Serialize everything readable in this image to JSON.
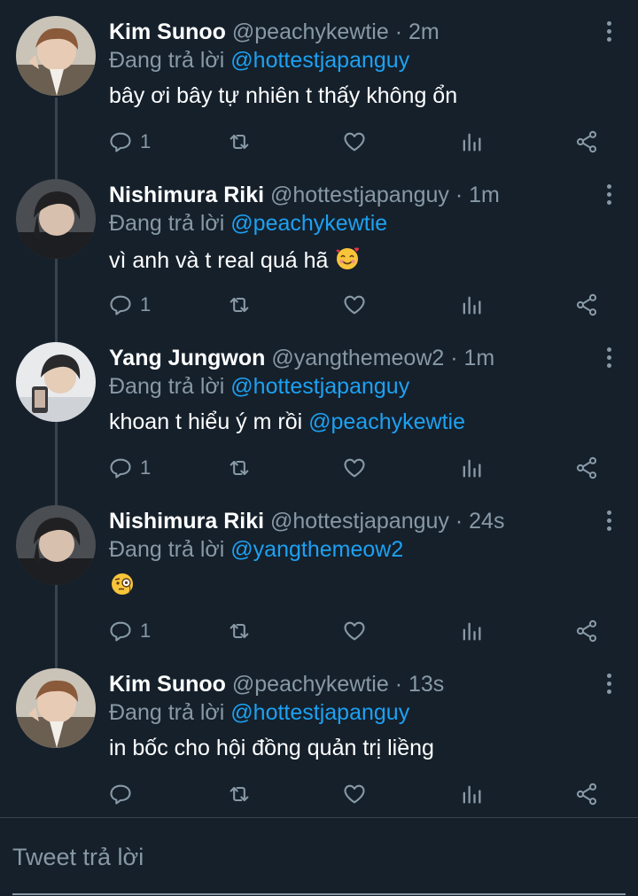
{
  "colors": {
    "background": "#15202b",
    "text": "#ffffff",
    "secondary": "#8899a6",
    "accent": "#1da1f2",
    "thread_line": "#38444d"
  },
  "reply_prefix": "Đang trả lời",
  "tweets": [
    {
      "name": "Kim Sunoo",
      "handle": "@peachykewtie",
      "dot": "·",
      "time": "2m",
      "replying_to": "@hottestjapanguy",
      "text": "bây ơi bây tự nhiên t thấy không ổn",
      "mention": "",
      "emoji": "",
      "reply_count": "1"
    },
    {
      "name": "Nishimura Riki",
      "handle": "@hottestjapanguy",
      "dot": "·",
      "time": "1m",
      "replying_to": "@peachykewtie",
      "text": "vì anh và t real quá hã",
      "mention": "",
      "emoji": "smiling-face-with-hearts",
      "reply_count": "1"
    },
    {
      "name": "Yang Jungwon",
      "handle": "@yangthemeow2",
      "dot": "·",
      "time": "1m",
      "replying_to": "@hottestjapanguy",
      "text": "khoan t hiểu ý m rồi",
      "mention": "@peachykewtie",
      "emoji": "",
      "reply_count": "1"
    },
    {
      "name": "Nishimura Riki",
      "handle": "@hottestjapanguy",
      "dot": "·",
      "time": "24s",
      "replying_to": "@yangthemeow2",
      "text": "",
      "mention": "",
      "emoji": "face-with-monocle",
      "reply_count": "1"
    },
    {
      "name": "Kim Sunoo",
      "handle": "@peachykewtie",
      "dot": "·",
      "time": "13s",
      "replying_to": "@hottestjapanguy",
      "text": "in bốc cho hội đồng quản trị liềng",
      "mention": "",
      "emoji": "",
      "reply_count": ""
    }
  ],
  "compose": {
    "placeholder": "Tweet trả lời"
  }
}
